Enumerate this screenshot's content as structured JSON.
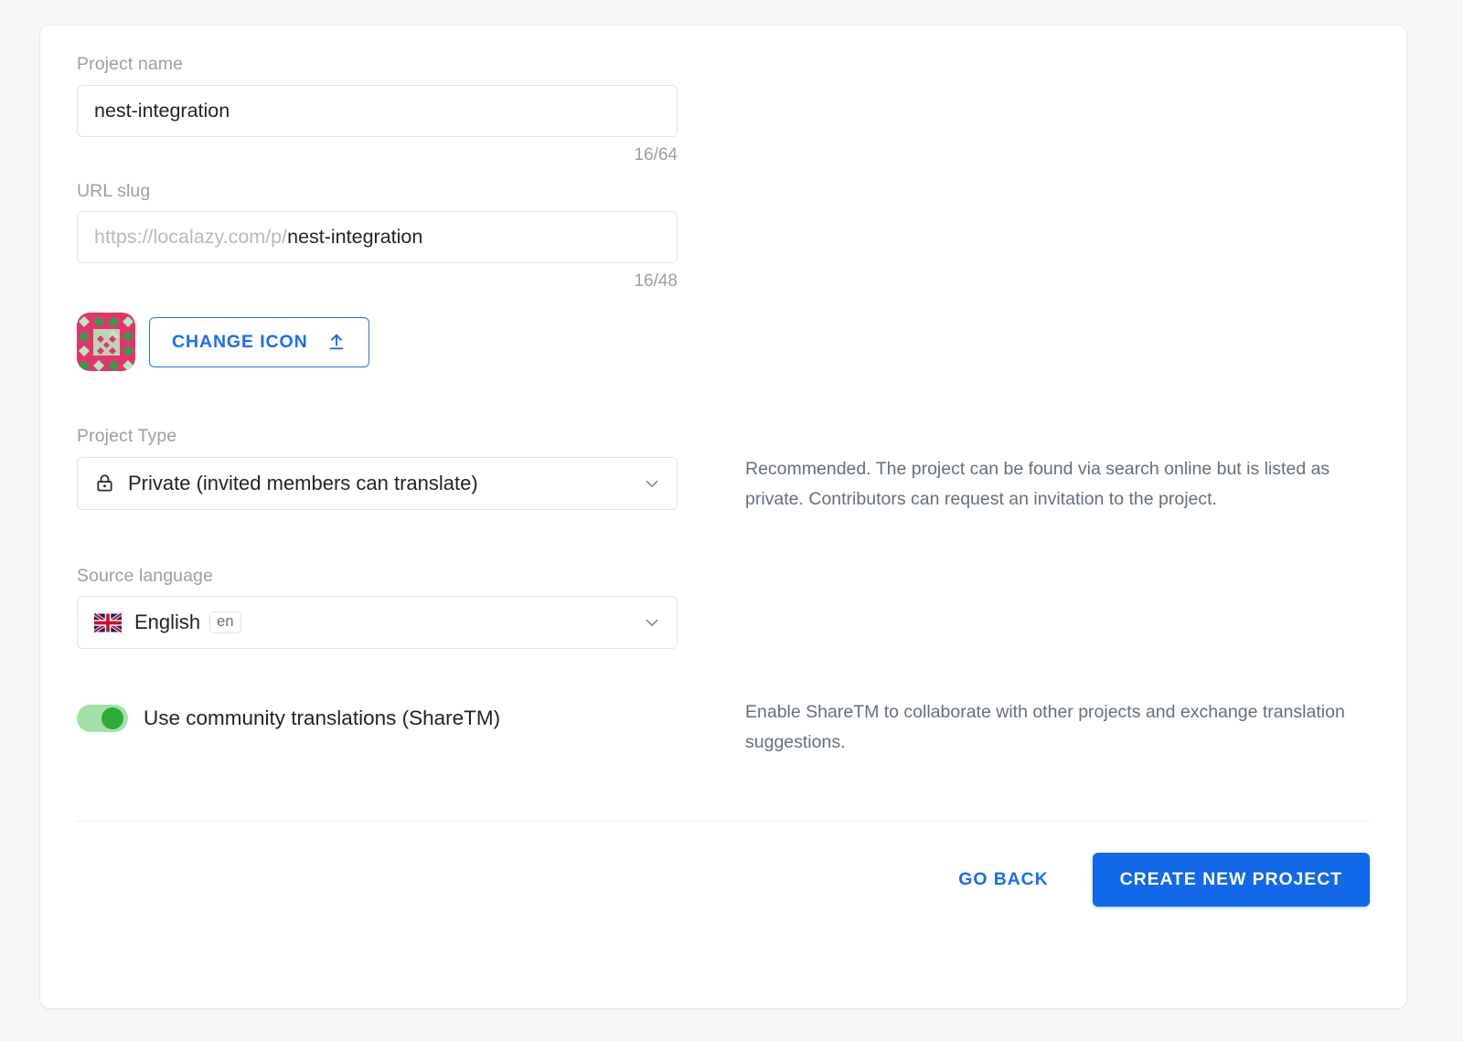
{
  "form": {
    "project_name": {
      "label": "Project name",
      "value": "nest-integration",
      "placeholder": "Project name",
      "counter": "16/64"
    },
    "url_slug": {
      "label": "URL slug",
      "prefix": "https://localazy.com/p/",
      "value": "nest-integration",
      "counter": "16/48"
    },
    "icon": {
      "change_button_label": "CHANGE ICON",
      "upload_icon": "upload-icon",
      "colors": {
        "background": "#e4346b",
        "diamond_dark": "#2e9e4f",
        "diamond_light": "#b9e8c4",
        "overlay": "#9fd9ac"
      }
    },
    "project_type": {
      "label": "Project Type",
      "value": "Private (invited members can translate)",
      "lead_icon": "lock-icon",
      "chevron": "chevron-down-icon",
      "description": "Recommended. The project can be found via search online but is listed as private. Contributors can request an invitation to the project."
    },
    "source_language": {
      "label": "Source language",
      "value": "English",
      "code_badge": "en",
      "flag_icon": "flag-gb-icon",
      "chevron": "chevron-down-icon"
    },
    "share_tm": {
      "label": "Use community translations (ShareTM)",
      "enabled": true,
      "description": "Enable ShareTM to collaborate with other projects and exchange translation suggestions."
    }
  },
  "footer": {
    "go_back_label": "GO BACK",
    "create_label": "CREATE NEW PROJECT"
  },
  "colors": {
    "accent_blue": "#1168e8",
    "link_blue": "#1a6ef0",
    "toggle_on": "#2eab34",
    "page_background": "#f7f7f8"
  }
}
